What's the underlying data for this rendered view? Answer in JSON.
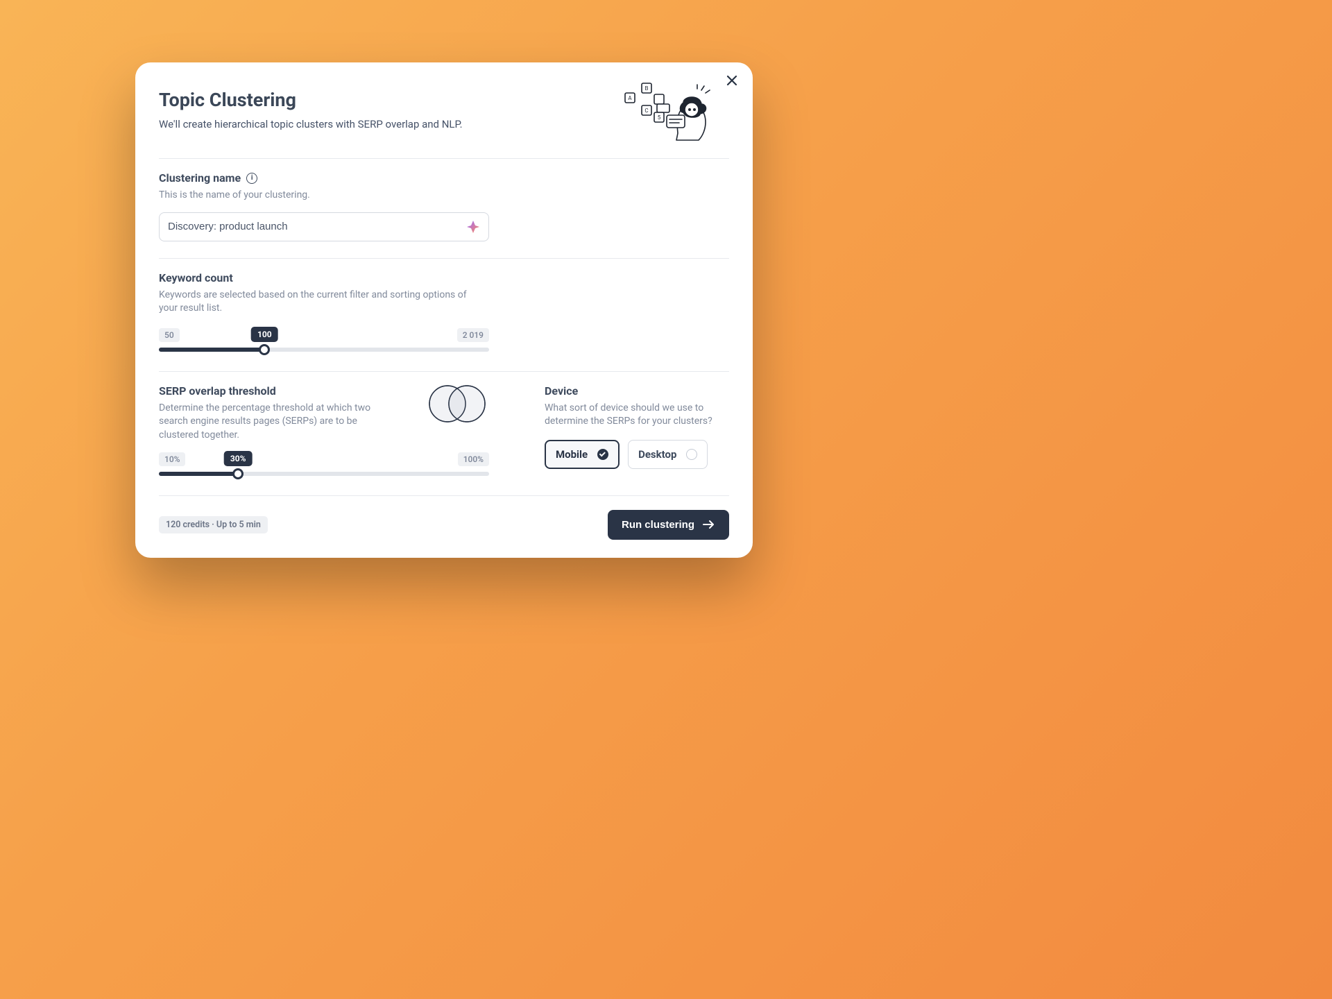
{
  "modal": {
    "title": "Topic Clustering",
    "subtitle": "We'll create hierarchical topic clusters with SERP overlap and NLP."
  },
  "name": {
    "label": "Clustering name",
    "help": "This is the name of your clustering.",
    "value": "Discovery: product launch"
  },
  "keyword": {
    "label": "Keyword count",
    "help": "Keywords are selected based on the current filter and sorting options of your result list.",
    "min": "50",
    "max": "2 019",
    "value": "100",
    "percent": 32
  },
  "serp": {
    "label": "SERP overlap threshold",
    "help": "Determine the percentage threshold at which two search engine results pages (SERPs) are to be clustered together.",
    "min": "10%",
    "max": "100%",
    "value": "30%",
    "percent": 24
  },
  "device": {
    "label": "Device",
    "help": "What sort of device should we use to determine the SERPs for your clusters?",
    "options": {
      "mobile": "Mobile",
      "desktop": "Desktop"
    },
    "selected": "mobile"
  },
  "footer": {
    "credits": "120 credits · Up to 5 min",
    "cta": "Run clustering"
  }
}
